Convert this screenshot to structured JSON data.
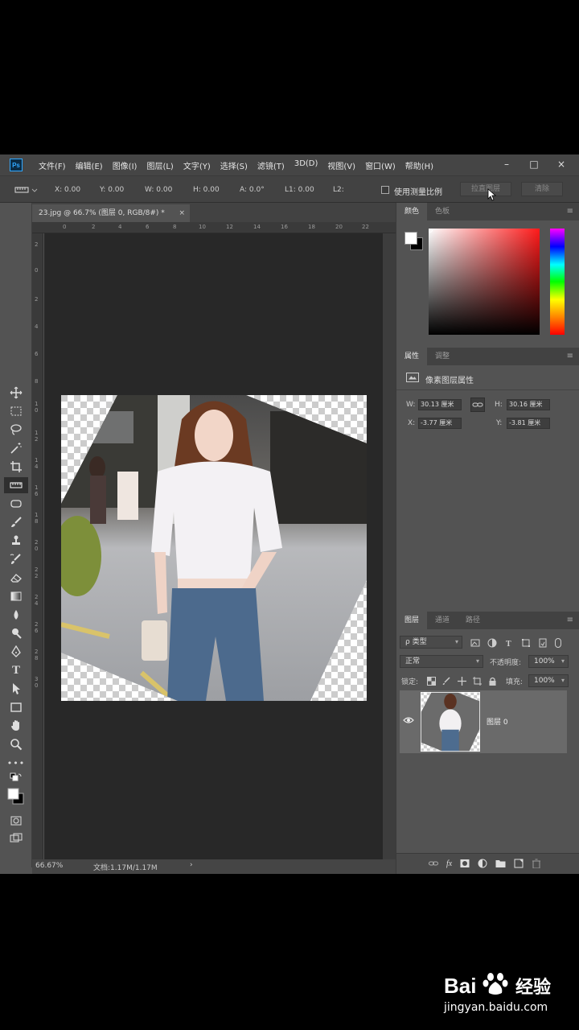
{
  "menubar": {
    "logo": "Ps",
    "menus": [
      "文件(F)",
      "编辑(E)",
      "图像(I)",
      "图层(L)",
      "文字(Y)",
      "选择(S)",
      "滤镜(T)",
      "3D(D)",
      "视图(V)",
      "窗口(W)",
      "帮助(H)"
    ],
    "window_controls": [
      "–",
      "□",
      "×"
    ]
  },
  "options": {
    "x": "X: 0.00",
    "y": "Y: 0.00",
    "w": "W: 0.00",
    "h": "H: 0.00",
    "a": "A: 0.0°",
    "l1": "L1: 0.00",
    "l2": "L2:",
    "use_scale": "使用测量比例",
    "straighten": "拉直图层",
    "clear": "清除"
  },
  "document": {
    "tab_title": "23.jpg @ 66.7% (图层 0, RGB/8#) *",
    "close": "×",
    "ruler_h": [
      "0",
      "2",
      "4",
      "6",
      "8",
      "10",
      "12",
      "14",
      "16",
      "18",
      "20",
      "22"
    ],
    "ruler_v": [
      "2",
      "0",
      "2",
      "4",
      "6",
      "8",
      "1",
      "0",
      "1",
      "2",
      "1",
      "4",
      "1",
      "6",
      "1",
      "8",
      "2",
      "0",
      "2",
      "2",
      "2",
      "4",
      "2",
      "6",
      "2",
      "8",
      "3",
      "0"
    ]
  },
  "status": {
    "zoom": "66.67%",
    "doc": "文档:1.17M/1.17M",
    "arrow": "›"
  },
  "color_panel": {
    "tabs": [
      "颜色",
      "色板"
    ],
    "fg_color": "#ffffff",
    "bg_color": "#000000",
    "hue_color": "#ff2020"
  },
  "properties_panel": {
    "tabs": [
      "属性",
      "调整"
    ],
    "header": "像素图层属性",
    "w_label": "W:",
    "w_value": "30.13 厘米",
    "h_label": "H:",
    "h_value": "30.16 厘米",
    "x_label": "X:",
    "x_value": "-3.77 厘米",
    "y_label": "Y:",
    "y_value": "-3.81 厘米"
  },
  "layers_panel": {
    "tabs": [
      "图层",
      "通道",
      "路径"
    ],
    "filter_kind": "ρ 类型",
    "blend_mode": "正常",
    "opacity_label": "不透明度:",
    "opacity_value": "100%",
    "lock_label": "锁定:",
    "fill_label": "填充:",
    "fill_value": "100%",
    "layers": [
      {
        "name": "图层 0",
        "visible": true
      }
    ],
    "footer_icons": [
      "link-icon",
      "fx-icon",
      "mask-icon",
      "adjustment-icon",
      "folder-icon",
      "new-layer-icon",
      "trash-icon"
    ],
    "fx": "fx"
  },
  "watermark": {
    "brand": "Bai",
    "brand2": "经验",
    "url": "jingyan.baidu.com"
  }
}
